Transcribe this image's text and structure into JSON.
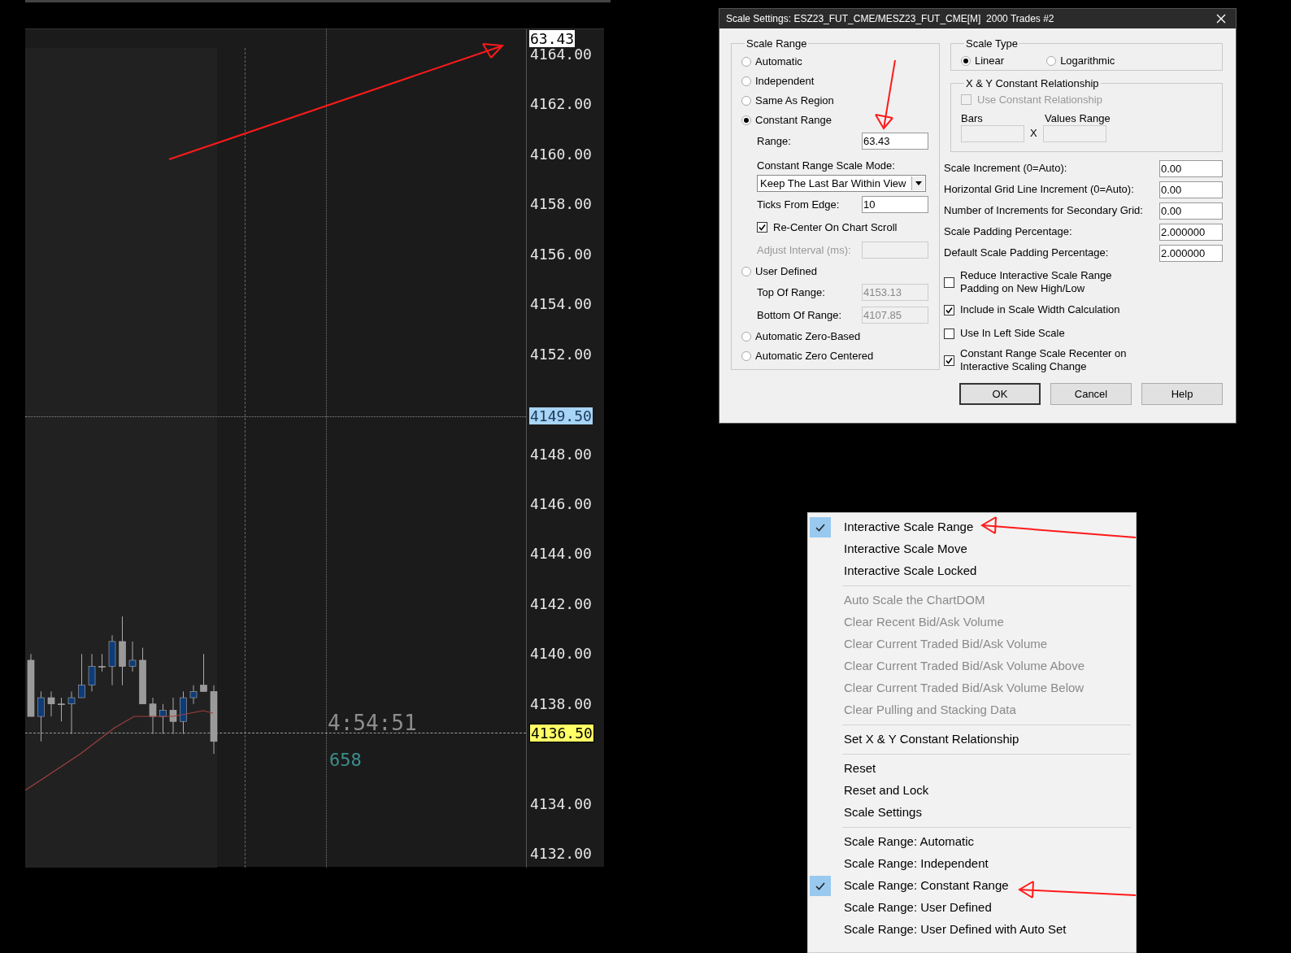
{
  "chart": {
    "price_labels": [
      "4164.00",
      "4162.00",
      "4160.00",
      "4158.00",
      "4156.00",
      "4154.00",
      "4152.00",
      "4148.00",
      "4146.00",
      "4144.00",
      "4142.00",
      "4140.00",
      "4138.00",
      "4134.00",
      "4132.00"
    ],
    "range_label": "63.43",
    "crosshair_price": "4149.50",
    "last_price": "4136.50",
    "bar_timer": "4:54:51",
    "volume": "658"
  },
  "dialog": {
    "title": "Scale Settings: ESZ23_FUT_CME/MESZ23_FUT_CME[M]  2000 Trades #2",
    "scale_range": {
      "legend": "Scale Range",
      "items": [
        {
          "kind": "radio",
          "label": "Automatic",
          "selected": false
        },
        {
          "kind": "radio",
          "label": "Independent",
          "selected": false
        },
        {
          "kind": "radio",
          "label": "Same As Region",
          "selected": false
        },
        {
          "kind": "radio",
          "label": "Constant Range",
          "selected": true
        },
        {
          "kind": "field",
          "label": "Range:",
          "value": "63.43",
          "disabled": false,
          "dimmed": false
        },
        {
          "kind": "label",
          "label": "Constant Range Scale Mode:"
        },
        {
          "kind": "select",
          "value": "Keep The Last Bar Within View"
        },
        {
          "kind": "field",
          "label": "Ticks From Edge:",
          "value": "10",
          "disabled": false,
          "dimmed": false
        },
        {
          "kind": "checkbox",
          "label": "Re-Center On Chart Scroll",
          "checked": true
        },
        {
          "kind": "field",
          "label": "Adjust Interval (ms):",
          "disabled": true,
          "dimmed": true
        },
        {
          "kind": "radio",
          "label": "User Defined",
          "selected": false
        },
        {
          "kind": "field",
          "label": "Top Of Range:",
          "value": "4153.13",
          "disabled": true,
          "dimmed": false
        },
        {
          "kind": "field",
          "label": "Bottom Of Range:",
          "value": "4107.85",
          "disabled": true,
          "dimmed": false
        },
        {
          "kind": "radio",
          "label": "Automatic Zero-Based",
          "selected": false
        },
        {
          "kind": "radio",
          "label": "Automatic Zero Centered",
          "selected": false
        }
      ]
    },
    "scale_type": {
      "legend": "Scale Type",
      "options": [
        {
          "label": "Linear",
          "selected": true
        },
        {
          "label": "Logarithmic",
          "selected": false
        }
      ]
    },
    "xy_relationship": {
      "legend": "X & Y Constant Relationship",
      "checkbox": {
        "label": "Use Constant Relationship",
        "checked": false,
        "disabled": true
      },
      "bars_label": "Bars",
      "values_label": "Values Range",
      "times_label": "X"
    },
    "fields": [
      {
        "label": "Scale Increment (0=Auto):",
        "value": "0.00"
      },
      {
        "label": "Horizontal Grid Line Increment (0=Auto):",
        "value": "0.00"
      },
      {
        "label": "Number of Increments for Secondary Grid:",
        "value": "0.00"
      },
      {
        "label": "Scale Padding Percentage:",
        "value": "2.000000"
      },
      {
        "label": "Default Scale Padding Percentage:",
        "value": "2.000000"
      }
    ],
    "checkboxes": [
      {
        "label": "Reduce Interactive Scale Range Padding on New High/Low",
        "checked": false
      },
      {
        "label": "Include in Scale Width Calculation",
        "checked": true
      },
      {
        "label": "Use In Left Side Scale",
        "checked": false
      },
      {
        "label": "Constant Range Scale Recenter on Interactive Scaling Change",
        "checked": true
      }
    ],
    "buttons": [
      {
        "label": "OK",
        "default": true
      },
      {
        "label": "Cancel",
        "default": false
      },
      {
        "label": "Help",
        "default": false
      }
    ]
  },
  "menu": {
    "items": [
      {
        "kind": "item",
        "label": "Interactive Scale Range",
        "checked": true,
        "disabled": false
      },
      {
        "kind": "item",
        "label": "Interactive Scale Move",
        "checked": false,
        "disabled": false
      },
      {
        "kind": "item",
        "label": "Interactive Scale Locked",
        "checked": false,
        "disabled": false
      },
      {
        "kind": "separator"
      },
      {
        "kind": "item",
        "label": "Auto Scale the ChartDOM",
        "checked": false,
        "disabled": true
      },
      {
        "kind": "item",
        "label": "Clear Recent Bid/Ask Volume",
        "checked": false,
        "disabled": true
      },
      {
        "kind": "item",
        "label": "Clear Current Traded Bid/Ask Volume",
        "checked": false,
        "disabled": true
      },
      {
        "kind": "item",
        "label": "Clear Current Traded Bid/Ask Volume Above",
        "checked": false,
        "disabled": true
      },
      {
        "kind": "item",
        "label": "Clear Current Traded Bid/Ask Volume Below",
        "checked": false,
        "disabled": true
      },
      {
        "kind": "item",
        "label": "Clear Pulling and Stacking Data",
        "checked": false,
        "disabled": true
      },
      {
        "kind": "separator"
      },
      {
        "kind": "item",
        "label": "Set X & Y Constant Relationship",
        "checked": false,
        "disabled": false
      },
      {
        "kind": "separator"
      },
      {
        "kind": "item",
        "label": "Reset",
        "checked": false,
        "disabled": false
      },
      {
        "kind": "item",
        "label": "Reset and Lock",
        "checked": false,
        "disabled": false
      },
      {
        "kind": "item",
        "label": "Scale Settings",
        "checked": false,
        "disabled": false
      },
      {
        "kind": "separator"
      },
      {
        "kind": "item",
        "label": "Scale Range: Automatic",
        "checked": false,
        "disabled": false
      },
      {
        "kind": "item",
        "label": "Scale Range: Independent",
        "checked": false,
        "disabled": false
      },
      {
        "kind": "item",
        "label": "Scale Range: Constant Range",
        "checked": true,
        "disabled": false
      },
      {
        "kind": "item",
        "label": "Scale Range: User Defined",
        "checked": false,
        "disabled": false
      },
      {
        "kind": "item",
        "label": "Scale Range: User Defined with Auto Set",
        "checked": false,
        "disabled": false
      }
    ]
  }
}
